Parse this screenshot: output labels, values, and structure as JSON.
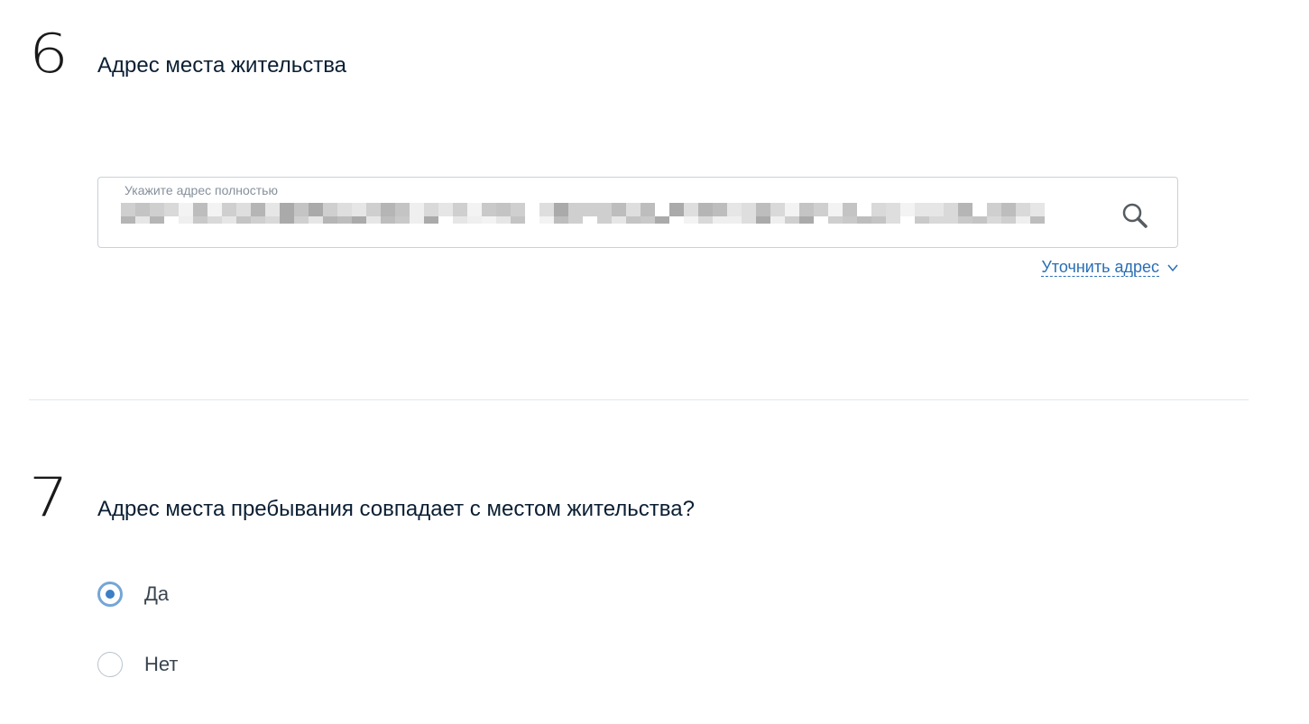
{
  "steps": [
    {
      "number": "6",
      "title": "Адрес места жительства",
      "address": {
        "label": "Укажите адрес полностью",
        "value_redacted": true,
        "search_icon": "search-icon",
        "refine_link": "Уточнить адрес",
        "refine_icon": "chevron-down-icon"
      }
    },
    {
      "number": "7",
      "title": "Адрес места пребывания совпадает с местом жительства?",
      "options": [
        {
          "label": "Да",
          "checked": true
        },
        {
          "label": "Нет",
          "checked": false
        }
      ]
    }
  ],
  "colors": {
    "link": "#2a6fb5",
    "radio_checked": "#74a6d6",
    "border": "#c9d1d8",
    "divider": "#e3e7eb"
  }
}
